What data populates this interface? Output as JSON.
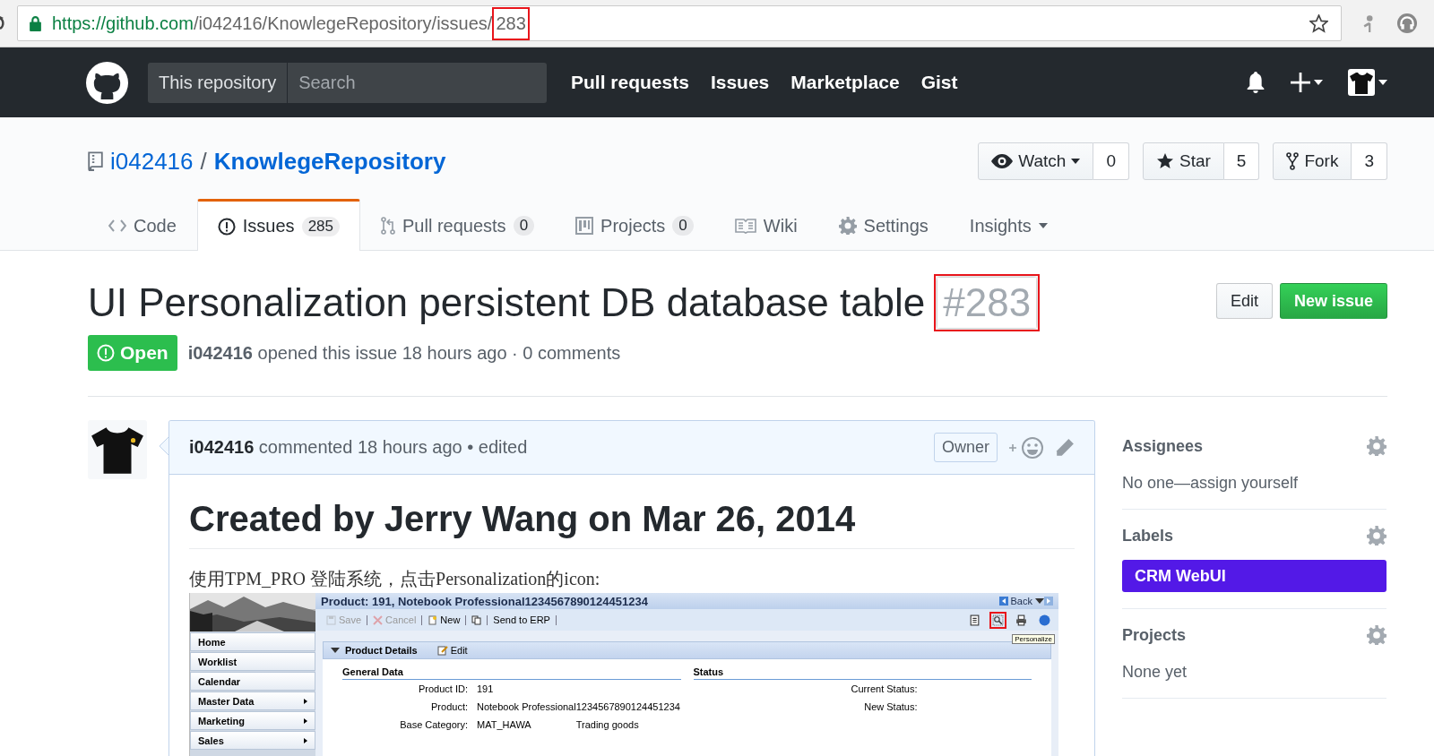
{
  "browser": {
    "url": [
      {
        "text": "https://",
        "kind": "scheme"
      },
      {
        "text": "github.com",
        "kind": "host"
      },
      {
        "text": "/i042416/KnowlegeRepository/issues/",
        "kind": "path"
      },
      {
        "text": "283",
        "kind": "highlight"
      }
    ]
  },
  "header": {
    "scope": "This repository",
    "search_placeholder": "Search",
    "nav": [
      "Pull requests",
      "Issues",
      "Marketplace",
      "Gist"
    ]
  },
  "repo": {
    "owner": "i042416",
    "separator": "/",
    "name": "KnowlegeRepository",
    "actions": [
      {
        "kind": "watch",
        "label": "Watch",
        "count": "0",
        "menu": true
      },
      {
        "kind": "star",
        "label": "Star",
        "count": "5"
      },
      {
        "kind": "fork",
        "label": "Fork",
        "count": "3"
      }
    ]
  },
  "tabs": [
    {
      "kind": "code",
      "label": "Code",
      "selected": false
    },
    {
      "kind": "issues",
      "label": "Issues",
      "count": "285",
      "selected": true
    },
    {
      "kind": "pulls",
      "label": "Pull requests",
      "count": "0",
      "selected": false
    },
    {
      "kind": "projects",
      "label": "Projects",
      "count": "0",
      "selected": false
    },
    {
      "kind": "wiki",
      "label": "Wiki",
      "selected": false
    },
    {
      "kind": "settings",
      "label": "Settings",
      "selected": false
    },
    {
      "kind": "insights",
      "label": "Insights",
      "menu": true,
      "selected": false
    }
  ],
  "issue": {
    "title": "UI Personalization persistent DB database table",
    "number": "#283",
    "number_highlighted": true,
    "buttons": [
      {
        "kind": "edit",
        "label": "Edit"
      },
      {
        "kind": "new",
        "label": "New issue"
      }
    ],
    "status": "Open",
    "author": "i042416",
    "meta": "opened this issue 18 hours ago · 0 comments"
  },
  "comment": {
    "author": "i042416",
    "meta": "commented 18 hours ago • edited",
    "badge": "Owner",
    "heading": "Created by Jerry Wang on Mar 26, 2014",
    "text": "使用TPM_PRO 登陆系统，点击Personalization的icon:",
    "screenshot": {
      "title": "Product: 191, Notebook Professional1234567890124451234",
      "back": "Back",
      "toolbar": [
        {
          "kind": "save",
          "label": "Save",
          "disabled": true
        },
        {
          "kind": "cancel",
          "label": "Cancel",
          "disabled": true
        },
        {
          "kind": "new",
          "label": "New",
          "disabled": false
        },
        {
          "kind": "copy",
          "disabled": false
        },
        {
          "kind": "send",
          "label": "Send to ERP",
          "disabled": false
        }
      ],
      "tools": [
        {
          "kind": "notes",
          "highlighted": false
        },
        {
          "kind": "personalize",
          "highlighted": true
        },
        {
          "kind": "print",
          "highlighted": false
        },
        {
          "kind": "help",
          "highlighted": false
        }
      ],
      "tooltip": "Personalize",
      "nav": [
        {
          "label": "Home",
          "submenu": false
        },
        {
          "label": "Worklist",
          "submenu": false
        },
        {
          "label": "Calendar",
          "submenu": false
        },
        {
          "label": "Master Data",
          "submenu": true
        },
        {
          "label": "Marketing",
          "submenu": true
        },
        {
          "label": "Sales",
          "submenu": true
        }
      ],
      "panel": {
        "title": "Product Details",
        "edit": "Edit",
        "sections": [
          {
            "title": "General Data",
            "fields": [
              {
                "label": "Product ID:",
                "value": "191"
              },
              {
                "label": "Product:",
                "value": "Notebook Professional1234567890124451234"
              },
              {
                "label": "Base Category:",
                "value": "MAT_HAWA",
                "extra": "Trading goods"
              }
            ]
          },
          {
            "title": "Status",
            "fields": [
              {
                "label": "Current Status:"
              },
              {
                "label": "New Status:"
              }
            ]
          }
        ]
      }
    }
  },
  "sidebar": [
    {
      "title": "Assignees",
      "kind": "text",
      "text": "No one—assign yourself"
    },
    {
      "title": "Labels",
      "kind": "labels",
      "labels": [
        {
          "name": "CRM WebUI",
          "color": "#5319e7"
        }
      ]
    },
    {
      "title": "Projects",
      "kind": "text",
      "text": "None yet"
    }
  ]
}
